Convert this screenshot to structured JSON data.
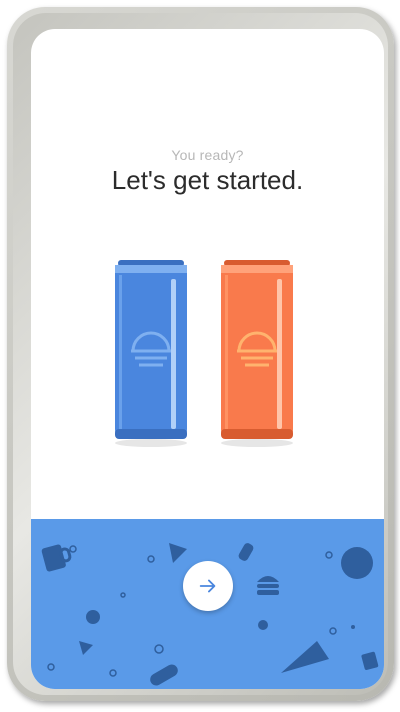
{
  "onboarding": {
    "subtitle": "You ready?",
    "headline": "Let's get started."
  },
  "next_button": {
    "icon": "arrow-right-icon"
  },
  "cans": [
    {
      "name": "blue-soda-can",
      "color": "#4a86de"
    },
    {
      "name": "orange-soda-can",
      "color": "#f97a4c"
    }
  ],
  "colors": {
    "panel": "#5a9ae8",
    "pattern": "#2f5f9e",
    "text_primary": "#2c2c2c",
    "text_secondary": "#b7b7b7"
  }
}
